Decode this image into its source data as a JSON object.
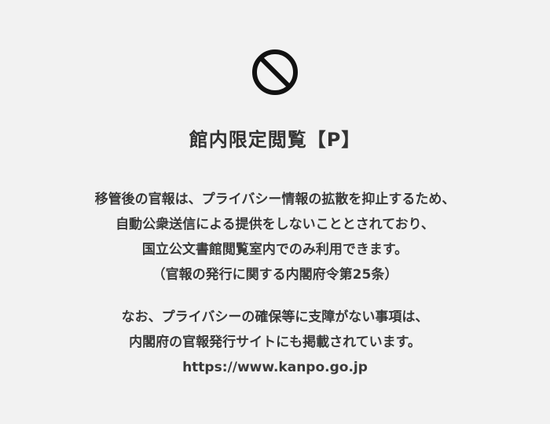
{
  "icon": "no-entry-icon",
  "title": "館内限定閲覧【P】",
  "message": {
    "paragraph1": [
      "移管後の官報は、プライバシー情報の拡散を抑止するため、",
      "自動公衆送信による提供をしないこととされており、",
      "国立公文書館閲覧室内でのみ利用できます。",
      "（官報の発行に関する内閣府令第25条）"
    ],
    "paragraph2": [
      "なお、プライバシーの確保等に支障がない事項は、",
      "内閣府の官報発行サイトにも掲載されています。",
      "https://www.kanpo.go.jp"
    ]
  }
}
